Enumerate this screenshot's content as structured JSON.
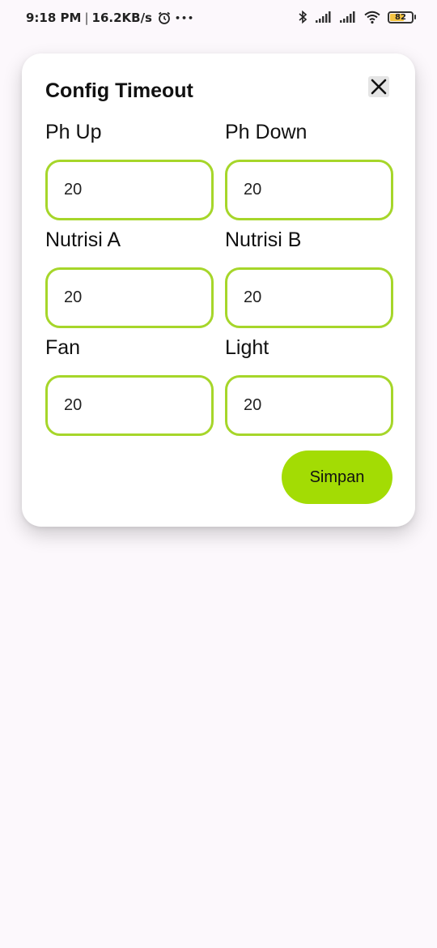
{
  "status_bar": {
    "time": "9:18 PM",
    "separator": "|",
    "network_speed": "16.2KB/s",
    "overflow_dots": "•••",
    "battery_level": "82"
  },
  "dialog": {
    "title": "Config Timeout",
    "close_icon": "close-icon",
    "fields": [
      {
        "label": "Ph Up",
        "value": "20"
      },
      {
        "label": "Ph Down",
        "value": "20"
      },
      {
        "label": "Nutrisi A",
        "value": "20"
      },
      {
        "label": "Nutrisi B",
        "value": "20"
      },
      {
        "label": "Fan",
        "value": "20"
      },
      {
        "label": "Light",
        "value": "20"
      }
    ],
    "save_label": "Simpan"
  },
  "colors": {
    "accent": "#a3dc04",
    "input_border": "#a6d62a",
    "background": "#fcf8fc"
  }
}
